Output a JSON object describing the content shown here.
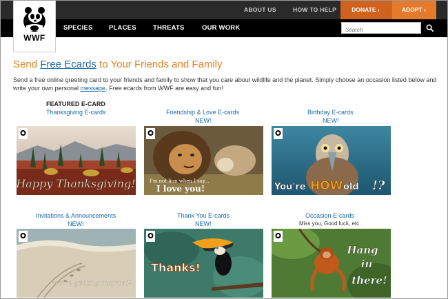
{
  "brand": {
    "logo_text": "WWF"
  },
  "top_links": {
    "about": "ABOUT US",
    "help": "HOW TO HELP",
    "donate": "DONATE ›",
    "adopt": "ADOPT ›"
  },
  "nav": {
    "species": "SPECIES",
    "places": "PLACES",
    "threats": "THREATS",
    "our_work": "OUR WORK"
  },
  "search": {
    "placeholder": "Search"
  },
  "colors": {
    "accent_orange": "#e0821e",
    "link_blue": "#1a6aa8",
    "donate_bg": "#d1621d",
    "adopt_bg": "#e57a2a"
  },
  "page": {
    "heading_before": "Send ",
    "heading_link": "Free Ecards",
    "heading_after": " to Your Friends and Family",
    "intro_before": "Send a free online greeting card to your friends and family to show that you care about wildlife and the planet. Simply choose an occasion listed below and write your own personal ",
    "intro_link": "message",
    "intro_after": ". Free ecards from WWF are easy and fun!"
  },
  "cards": [
    {
      "featured_label": "FEATURED E-CARD",
      "title": "Thanksgiving E-cards",
      "image_text": "Happy Thanksgiving!",
      "image_subject": "autumn-forest-landscape"
    },
    {
      "title": "Friendship & Love E-cards",
      "new_label": "NEW!",
      "image_text_1": "I'm not lion when I say...",
      "image_text_2": "I love you!",
      "image_subject": "lions"
    },
    {
      "title": "Birthday E-cards",
      "new_label": "NEW!",
      "image_text_1": "You're",
      "image_text_2": "HOW",
      "image_text_3": "old",
      "image_text_4": "!?",
      "image_subject": "booby-bird"
    },
    {
      "title": "Invitations & Announcements",
      "new_label": "NEW!",
      "image_text": "we're getting married!",
      "image_subject": "turtle-tracks-on-beach"
    },
    {
      "title": "Thank You E-cards",
      "new_label": "NEW!",
      "image_text": "Thanks!",
      "image_subject": "toucan"
    },
    {
      "title": "Occasion E-cards",
      "subtitle": "Miss you, Good luck, etc.",
      "image_text_1": "Hang",
      "image_text_2": "in",
      "image_text_3": "there!",
      "image_subject": "orangutan"
    }
  ]
}
